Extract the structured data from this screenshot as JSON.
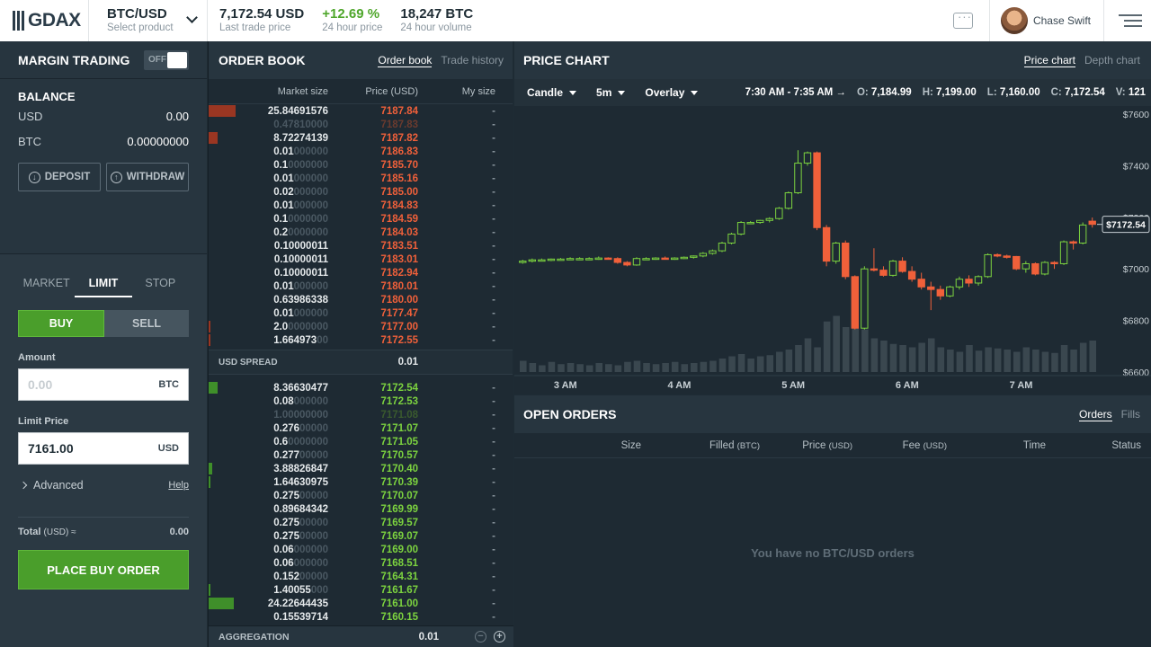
{
  "header": {
    "logo": "GDAX",
    "product": {
      "name": "BTC/USD",
      "sub": "Select product"
    },
    "stats": [
      {
        "value": "7,172.54 USD",
        "label": "Last trade price",
        "color": "#1f2d35"
      },
      {
        "value": "+12.69 %",
        "label": "24 hour price",
        "color": "#4ea62a"
      },
      {
        "value": "18,247 BTC",
        "label": "24 hour volume",
        "color": "#1f2d35"
      }
    ],
    "user": "Chase Swift"
  },
  "margin": {
    "title": "MARGIN TRADING",
    "toggle": "OFF"
  },
  "balance": {
    "title": "BALANCE",
    "rows": [
      {
        "k": "USD",
        "v": "0.00"
      },
      {
        "k": "BTC",
        "v": "0.00000000"
      }
    ],
    "deposit": "DEPOSIT",
    "withdraw": "WITHDRAW"
  },
  "order_form": {
    "tabs": [
      "MARKET",
      "LIMIT",
      "STOP"
    ],
    "buy": "BUY",
    "sell": "SELL",
    "amount_label": "Amount",
    "amount_placeholder": "0.00",
    "amount_unit": "BTC",
    "limit_label": "Limit Price",
    "limit_value": "7161.00",
    "limit_unit": "USD",
    "advanced": "Advanced",
    "help": "Help",
    "total_label": "Total",
    "total_unit": "(USD) ≈",
    "total_value": "0.00",
    "place": "PLACE BUY ORDER"
  },
  "order_book": {
    "title": "ORDER BOOK",
    "tab_active": "Order book",
    "tab_other": "Trade history",
    "col_size": "Market size",
    "col_price": "Price (USD)",
    "col_my": "My size",
    "asks": [
      {
        "s": "25.84691576",
        "d": "",
        "p": "7187.84",
        "bar": 30,
        "dim": false
      },
      {
        "s": "0.47810000",
        "d": "",
        "p": "7187.83",
        "bar": 0,
        "dim": true
      },
      {
        "s": "8.72274139",
        "d": "",
        "p": "7187.82",
        "bar": 10,
        "dim": false
      },
      {
        "s": "0.01",
        "d": "000000",
        "p": "7186.83",
        "bar": 0,
        "dim": false
      },
      {
        "s": "0.1",
        "d": "0000000",
        "p": "7185.70",
        "bar": 0,
        "dim": false
      },
      {
        "s": "0.01",
        "d": "000000",
        "p": "7185.16",
        "bar": 0,
        "dim": false
      },
      {
        "s": "0.02",
        "d": "000000",
        "p": "7185.00",
        "bar": 0,
        "dim": false
      },
      {
        "s": "0.01",
        "d": "000000",
        "p": "7184.83",
        "bar": 0,
        "dim": false
      },
      {
        "s": "0.1",
        "d": "0000000",
        "p": "7184.59",
        "bar": 0,
        "dim": false
      },
      {
        "s": "0.2",
        "d": "0000000",
        "p": "7184.03",
        "bar": 0,
        "dim": false
      },
      {
        "s": "0.10000011",
        "d": "",
        "p": "7183.51",
        "bar": 0,
        "dim": false
      },
      {
        "s": "0.10000011",
        "d": "",
        "p": "7183.01",
        "bar": 0,
        "dim": false
      },
      {
        "s": "0.10000011",
        "d": "",
        "p": "7182.94",
        "bar": 0,
        "dim": false
      },
      {
        "s": "0.01",
        "d": "000000",
        "p": "7180.01",
        "bar": 0,
        "dim": false
      },
      {
        "s": "0.63986338",
        "d": "",
        "p": "7180.00",
        "bar": 0,
        "dim": false
      },
      {
        "s": "0.01",
        "d": "000000",
        "p": "7177.47",
        "bar": 0,
        "dim": false
      },
      {
        "s": "2.0",
        "d": "0000000",
        "p": "7177.00",
        "bar": 2,
        "dim": false
      },
      {
        "s": "1.664973",
        "d": "00",
        "p": "7172.55",
        "bar": 2,
        "dim": false
      }
    ],
    "spread_label": "USD SPREAD",
    "spread_value": "0.01",
    "bids": [
      {
        "s": "8.36630477",
        "d": "",
        "p": "7172.54",
        "bar": 10,
        "dim": false
      },
      {
        "s": "0.08",
        "d": "000000",
        "p": "7172.53",
        "bar": 0,
        "dim": false
      },
      {
        "s": "1.00000000",
        "d": "",
        "p": "7171.08",
        "bar": 0,
        "dim": true
      },
      {
        "s": "0.276",
        "d": "00000",
        "p": "7171.07",
        "bar": 0,
        "dim": false
      },
      {
        "s": "0.6",
        "d": "0000000",
        "p": "7171.05",
        "bar": 0,
        "dim": false
      },
      {
        "s": "0.277",
        "d": "00000",
        "p": "7170.57",
        "bar": 0,
        "dim": false
      },
      {
        "s": "3.88826847",
        "d": "",
        "p": "7170.40",
        "bar": 4,
        "dim": false
      },
      {
        "s": "1.64630975",
        "d": "",
        "p": "7170.39",
        "bar": 2,
        "dim": false
      },
      {
        "s": "0.275",
        "d": "00000",
        "p": "7170.07",
        "bar": 0,
        "dim": false
      },
      {
        "s": "0.89684342",
        "d": "",
        "p": "7169.99",
        "bar": 0,
        "dim": false
      },
      {
        "s": "0.275",
        "d": "00000",
        "p": "7169.57",
        "bar": 0,
        "dim": false
      },
      {
        "s": "0.275",
        "d": "00000",
        "p": "7169.07",
        "bar": 0,
        "dim": false
      },
      {
        "s": "0.06",
        "d": "000000",
        "p": "7169.00",
        "bar": 0,
        "dim": false
      },
      {
        "s": "0.06",
        "d": "000000",
        "p": "7168.51",
        "bar": 0,
        "dim": false
      },
      {
        "s": "0.152",
        "d": "00000",
        "p": "7164.31",
        "bar": 0,
        "dim": false
      },
      {
        "s": "1.40055",
        "d": "000",
        "p": "7161.67",
        "bar": 2,
        "dim": false
      },
      {
        "s": "24.22644435",
        "d": "",
        "p": "7161.00",
        "bar": 28,
        "dim": false
      },
      {
        "s": "0.15539714",
        "d": "",
        "p": "7160.15",
        "bar": 0,
        "dim": false
      }
    ],
    "aggregation_label": "AGGREGATION",
    "aggregation_value": "0.01"
  },
  "price_chart": {
    "title": "PRICE CHART",
    "tab_active": "Price chart",
    "tab_other": "Depth chart",
    "type_dd": "Candle",
    "interval_dd": "5m",
    "overlay_dd": "Overlay",
    "range": "7:30 AM - 7:35 AM →",
    "ohlc": [
      {
        "k": "O:",
        "v": "7,184.99"
      },
      {
        "k": "H:",
        "v": "7,199.00"
      },
      {
        "k": "L:",
        "v": "7,160.00"
      },
      {
        "k": "C:",
        "v": "7,172.54"
      },
      {
        "k": "V:",
        "v": "121"
      }
    ],
    "last_price_tag": "$7172.54"
  },
  "chart_data": {
    "type": "candlestick",
    "y_ticks": [
      "$7600",
      "$7400",
      "$7200",
      "$7000",
      "$6800",
      "$6600"
    ],
    "y_tick_values": [
      7600,
      7400,
      7200,
      7000,
      6800,
      6600
    ],
    "ylim": [
      6600,
      7600
    ],
    "x_ticks": [
      "3 AM",
      "4 AM",
      "5 AM",
      "6 AM",
      "7 AM"
    ],
    "x_tick_index": [
      5,
      17,
      29,
      41,
      53
    ],
    "up_color": "#7cd33f",
    "down_color": "#f0603a",
    "candles": [
      {
        "o": 7025,
        "h": 7035,
        "l": 7020,
        "c": 7030
      },
      {
        "o": 7030,
        "h": 7040,
        "l": 7025,
        "c": 7035
      },
      {
        "o": 7035,
        "h": 7040,
        "l": 7030,
        "c": 7035
      },
      {
        "o": 7035,
        "h": 7040,
        "l": 7030,
        "c": 7038
      },
      {
        "o": 7038,
        "h": 7042,
        "l": 7032,
        "c": 7038
      },
      {
        "o": 7038,
        "h": 7045,
        "l": 7035,
        "c": 7040
      },
      {
        "o": 7040,
        "h": 7045,
        "l": 7035,
        "c": 7040
      },
      {
        "o": 7040,
        "h": 7045,
        "l": 7035,
        "c": 7040
      },
      {
        "o": 7040,
        "h": 7048,
        "l": 7035,
        "c": 7042
      },
      {
        "o": 7042,
        "h": 7045,
        "l": 7038,
        "c": 7040
      },
      {
        "o": 7040,
        "h": 7045,
        "l": 7020,
        "c": 7025
      },
      {
        "o": 7025,
        "h": 7030,
        "l": 7010,
        "c": 7015
      },
      {
        "o": 7015,
        "h": 7045,
        "l": 7012,
        "c": 7040
      },
      {
        "o": 7040,
        "h": 7045,
        "l": 7035,
        "c": 7040
      },
      {
        "o": 7040,
        "h": 7045,
        "l": 7035,
        "c": 7042
      },
      {
        "o": 7042,
        "h": 7048,
        "l": 7038,
        "c": 7040
      },
      {
        "o": 7040,
        "h": 7045,
        "l": 7035,
        "c": 7042
      },
      {
        "o": 7042,
        "h": 7048,
        "l": 7038,
        "c": 7045
      },
      {
        "o": 7045,
        "h": 7052,
        "l": 7040,
        "c": 7050
      },
      {
        "o": 7050,
        "h": 7065,
        "l": 7045,
        "c": 7060
      },
      {
        "o": 7060,
        "h": 7075,
        "l": 7055,
        "c": 7070
      },
      {
        "o": 7070,
        "h": 7105,
        "l": 7065,
        "c": 7100
      },
      {
        "o": 7100,
        "h": 7140,
        "l": 7095,
        "c": 7135
      },
      {
        "o": 7135,
        "h": 7185,
        "l": 7130,
        "c": 7180
      },
      {
        "o": 7180,
        "h": 7185,
        "l": 7175,
        "c": 7180
      },
      {
        "o": 7180,
        "h": 7190,
        "l": 7175,
        "c": 7188
      },
      {
        "o": 7188,
        "h": 7200,
        "l": 7180,
        "c": 7195
      },
      {
        "o": 7195,
        "h": 7240,
        "l": 7190,
        "c": 7235
      },
      {
        "o": 7235,
        "h": 7300,
        "l": 7230,
        "c": 7295
      },
      {
        "o": 7295,
        "h": 7460,
        "l": 7290,
        "c": 7410
      },
      {
        "o": 7410,
        "h": 7455,
        "l": 7400,
        "c": 7450
      },
      {
        "o": 7450,
        "h": 7455,
        "l": 7150,
        "c": 7160
      },
      {
        "o": 7160,
        "h": 7170,
        "l": 7010,
        "c": 7030
      },
      {
        "o": 7030,
        "h": 7105,
        "l": 7020,
        "c": 7100
      },
      {
        "o": 7100,
        "h": 7110,
        "l": 6960,
        "c": 6970
      },
      {
        "o": 6970,
        "h": 6975,
        "l": 6765,
        "c": 6770
      },
      {
        "o": 6770,
        "h": 7010,
        "l": 6765,
        "c": 7000
      },
      {
        "o": 7000,
        "h": 7080,
        "l": 6990,
        "c": 6995
      },
      {
        "o": 6995,
        "h": 7010,
        "l": 6970,
        "c": 6975
      },
      {
        "o": 6975,
        "h": 7035,
        "l": 6970,
        "c": 7030
      },
      {
        "o": 7030,
        "h": 7045,
        "l": 6985,
        "c": 6990
      },
      {
        "o": 6990,
        "h": 7010,
        "l": 6950,
        "c": 6960
      },
      {
        "o": 6960,
        "h": 6985,
        "l": 6920,
        "c": 6930
      },
      {
        "o": 6930,
        "h": 6950,
        "l": 6840,
        "c": 6920
      },
      {
        "o": 6920,
        "h": 6935,
        "l": 6880,
        "c": 6895
      },
      {
        "o": 6895,
        "h": 6935,
        "l": 6890,
        "c": 6930
      },
      {
        "o": 6930,
        "h": 6970,
        "l": 6920,
        "c": 6960
      },
      {
        "o": 6960,
        "h": 6975,
        "l": 6930,
        "c": 6945
      },
      {
        "o": 6945,
        "h": 6975,
        "l": 6935,
        "c": 6970
      },
      {
        "o": 6970,
        "h": 7060,
        "l": 6965,
        "c": 7055
      },
      {
        "o": 7055,
        "h": 7060,
        "l": 7045,
        "c": 7050
      },
      {
        "o": 7050,
        "h": 7055,
        "l": 7040,
        "c": 7048
      },
      {
        "o": 7048,
        "h": 7050,
        "l": 6995,
        "c": 7000
      },
      {
        "o": 7000,
        "h": 7030,
        "l": 6985,
        "c": 7020
      },
      {
        "o": 7020,
        "h": 7025,
        "l": 6975,
        "c": 6980
      },
      {
        "o": 6980,
        "h": 7030,
        "l": 6975,
        "c": 7025
      },
      {
        "o": 7025,
        "h": 7030,
        "l": 7000,
        "c": 7020
      },
      {
        "o": 7020,
        "h": 7110,
        "l": 7015,
        "c": 7105
      },
      {
        "o": 7105,
        "h": 7110,
        "l": 7075,
        "c": 7100
      },
      {
        "o": 7100,
        "h": 7180,
        "l": 7095,
        "c": 7170
      },
      {
        "o": 7185,
        "h": 7199,
        "l": 7160,
        "c": 7172.54
      }
    ],
    "volumes": [
      10,
      8,
      6,
      9,
      7,
      8,
      7,
      6,
      8,
      7,
      6,
      9,
      10,
      8,
      7,
      8,
      9,
      7,
      8,
      9,
      10,
      12,
      14,
      16,
      12,
      14,
      15,
      18,
      20,
      24,
      30,
      22,
      45,
      50,
      40,
      46,
      38,
      30,
      28,
      25,
      24,
      22,
      26,
      30,
      22,
      20,
      18,
      24,
      19,
      22,
      21,
      20,
      18,
      22,
      20,
      18,
      17,
      24,
      20,
      26,
      28
    ]
  },
  "open_orders": {
    "title": "OPEN ORDERS",
    "tab_active": "Orders",
    "tab_other": "Fills",
    "cols": {
      "size": "Size",
      "filled": "Filled",
      "filled_unit": "(BTC)",
      "price": "Price",
      "price_unit": "(USD)",
      "fee": "Fee",
      "fee_unit": "(USD)",
      "time": "Time",
      "status": "Status"
    },
    "empty": "You have no BTC/USD orders"
  }
}
